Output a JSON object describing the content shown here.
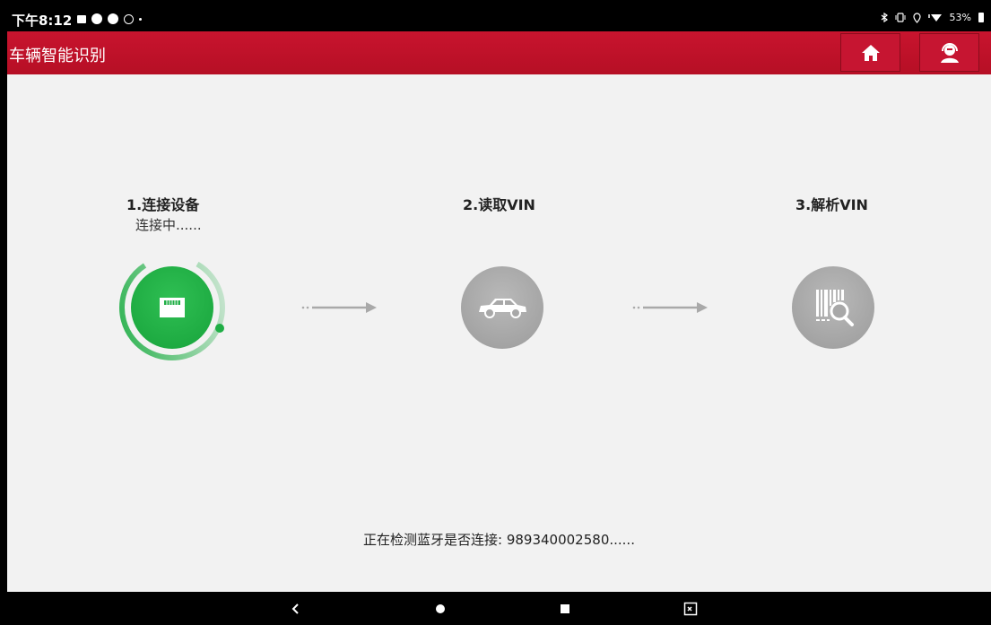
{
  "status_bar": {
    "time": "下午8:12",
    "battery": "53%",
    "icons": [
      "image-icon",
      "circle-icon",
      "circle-icon",
      "accessibility-icon",
      "dot-icon",
      "bluetooth-icon",
      "vibrate-icon",
      "location-icon",
      "wifi-icon",
      "battery-icon"
    ]
  },
  "header": {
    "title": "车辆智能识别",
    "home_icon": "home-icon",
    "support_icon": "support-agent-icon",
    "color": "#c0132c"
  },
  "steps": [
    {
      "label": "1.连接设备",
      "status": "连接中......",
      "icon": "obd-connector-icon",
      "state": "active",
      "color": "#1fae45"
    },
    {
      "label": "2.读取VIN",
      "icon": "car-icon",
      "state": "pending",
      "color": "#a8a8a8"
    },
    {
      "label": "3.解析VIN",
      "icon": "barcode-search-icon",
      "state": "pending",
      "color": "#a8a8a8"
    }
  ],
  "progress_message": "正在检测蓝牙是否连接: 989340002580......",
  "nav_bar": {
    "items": [
      "back-icon",
      "home-dot-icon",
      "recents-icon",
      "screenshot-icon"
    ]
  }
}
